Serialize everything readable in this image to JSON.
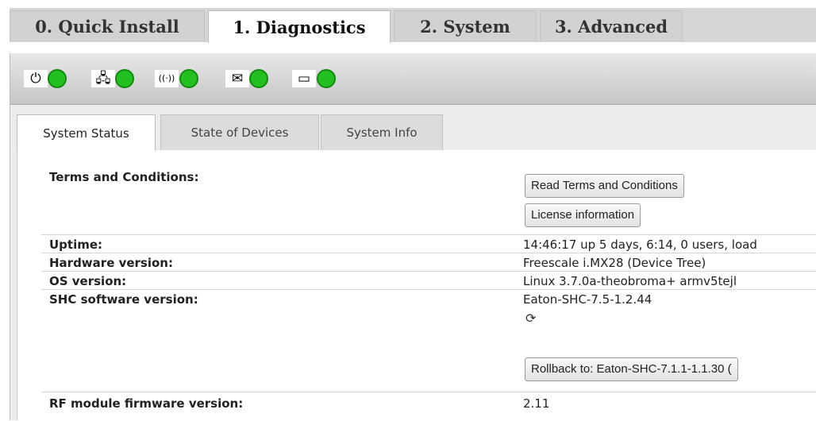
{
  "top_tabs": [
    "0. Quick Install",
    "1. Diagnostics",
    "2. System",
    "3. Advanced"
  ],
  "active_top_tab": "1. Diagnostics",
  "status_indicators": [
    {
      "icon": "power-icon",
      "glyph": "⏻",
      "color": "#22c020"
    },
    {
      "icon": "network-icon",
      "glyph": "🖧",
      "color": "#22c020"
    },
    {
      "icon": "wireless-icon",
      "glyph": "((·))",
      "color": "#22c020"
    },
    {
      "icon": "mail-icon",
      "glyph": "✉",
      "color": "#22c020"
    },
    {
      "icon": "battery-icon",
      "glyph": "▭",
      "color": "#22c020"
    }
  ],
  "sub_tabs": [
    "System Status",
    "State of Devices",
    "System Info"
  ],
  "active_sub_tab": "System Status",
  "status": {
    "terms_label": "Terms and Conditions:",
    "read_terms_button": "Read Terms and Conditions",
    "license_button": "License information",
    "uptime_label": "Uptime:",
    "uptime_value": "14:46:17 up 5 days, 6:14, 0 users, load",
    "hardware_label": "Hardware version:",
    "hardware_value": "Freescale i.MX28 (Device Tree)",
    "os_label": "OS version:",
    "os_value": "Linux 3.7.0a-theobroma+ armv5tejl",
    "shc_label": "SHC software version:",
    "shc_value": "Eaton-SHC-7.5-1.2.44",
    "refresh_glyph": "⟳",
    "rollback_button": "Rollback to: Eaton-SHC-7.1.1-1.1.30 (",
    "rf_label": "RF module firmware version:",
    "rf_value": "2.11"
  }
}
